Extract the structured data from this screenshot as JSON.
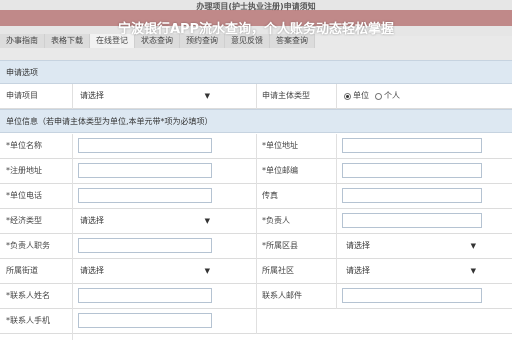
{
  "header": {
    "site_title": "办理项目(护士执业注册)申请须知",
    "overlay_caption": "宁波银行APP流水查询，个人账务动态轻松掌握"
  },
  "tabs": [
    "办事指南",
    "表格下载",
    "在线登记",
    "状态查询",
    "预约查询",
    "意见反馈",
    "答案查询"
  ],
  "form": {
    "section_apply": "申请选项",
    "apply_item_label": "申请项目",
    "apply_item_value": "请选择",
    "subject_type_label": "申请主体类型",
    "subject_options": [
      {
        "label": "单位",
        "checked": true
      },
      {
        "label": "个人",
        "checked": false
      }
    ],
    "section_unit": "单位信息（若申请主体类型为单位,本单元带*项为必填项）",
    "fields": {
      "unit_name": "*单位名称",
      "unit_address": "*单位地址",
      "reg_address": "*注册地址",
      "unit_postcode": "*单位邮编",
      "unit_phone": "*单位电话",
      "fax": "传真",
      "economy_type": "*经济类型",
      "economy_type_value": "请选择",
      "legal_person": "*负责人",
      "legal_duty": "*负责人职务",
      "region": "*所属区县",
      "region_value": "请选择",
      "street": "所属街道",
      "street_value": "请选择",
      "community": "所属社区",
      "community_value": "请选择",
      "contact_name": "*联系人姓名",
      "contact_email": "联系人邮件",
      "contact_mobile": "*联系人手机"
    }
  },
  "icons": {
    "dropdown": "triangle-down"
  }
}
